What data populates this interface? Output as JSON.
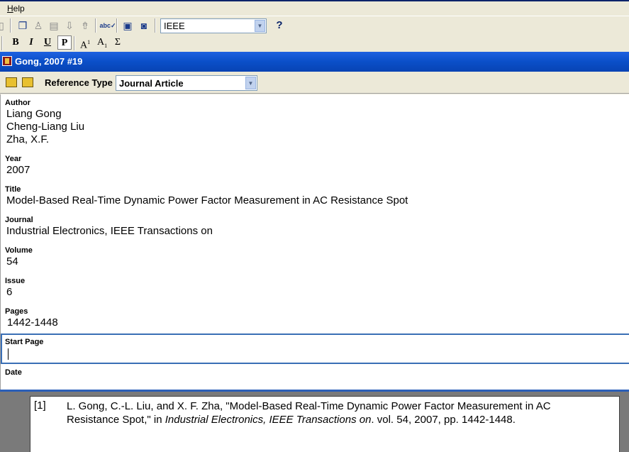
{
  "menubar": {
    "help": "Help"
  },
  "toolbar": {
    "output_style": "IEEE",
    "help_label": "?",
    "format_buttons": {
      "bold": "B",
      "italic": "I",
      "underline": "U",
      "plain": "P",
      "superscript": "A",
      "superscript_mark": "1",
      "subscript": "A",
      "subscript_mark": "1",
      "symbol": "Σ"
    }
  },
  "window": {
    "title": "Gong, 2007 #19"
  },
  "reference_type": {
    "label": "Reference Type",
    "value": "Journal Article"
  },
  "fields": {
    "author": {
      "label": "Author",
      "values": [
        "Liang Gong",
        "Cheng-Liang Liu",
        "Zha, X.F."
      ]
    },
    "year": {
      "label": "Year",
      "value": "2007"
    },
    "title": {
      "label": "Title",
      "value": "Model-Based Real-Time Dynamic Power Factor Measurement in AC Resistance Spot"
    },
    "journal": {
      "label": "Journal",
      "value": "Industrial Electronics, IEEE Transactions on"
    },
    "volume": {
      "label": "Volume",
      "value": "54"
    },
    "issue": {
      "label": "Issue",
      "value": "6"
    },
    "pages": {
      "label": "Pages",
      "value": "1442-1448"
    },
    "start_page": {
      "label": "Start Page",
      "value": ""
    },
    "date": {
      "label": "Date",
      "value": ""
    }
  },
  "preview": {
    "number": "[1]",
    "text_before": "L. Gong, C.-L. Liu, and X. F. Zha, \"Model-Based Real-Time Dynamic Power Factor Measurement in AC Resistance Spot,\" in ",
    "text_italic": "Industrial Electronics, IEEE Transactions on",
    "text_after": ". vol. 54, 2007, pp. 1442-1448."
  },
  "colors": {
    "title_bar": "#0a4fc8",
    "active_field_border": "#3a6fb5",
    "window_bg": "#ece9d8"
  }
}
